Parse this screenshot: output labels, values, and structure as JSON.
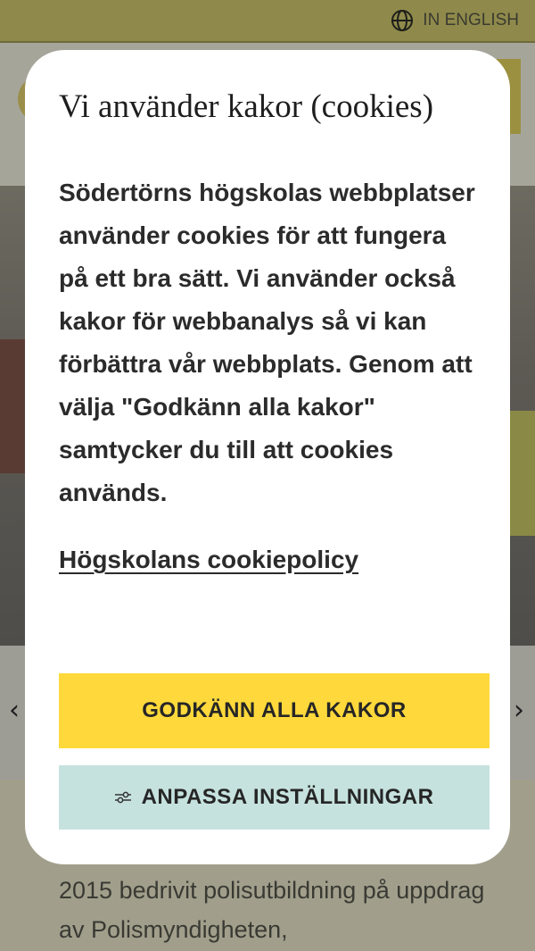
{
  "topbar": {
    "language_link": "IN ENGLISH",
    "language_icon": "globe-icon"
  },
  "cookie_modal": {
    "title": "Vi använder kakor (cookies)",
    "body": "Södertörns högskolas webbplatser använder cookies för att fungera på ett bra sätt. Vi använder också kakor för webbanalys så vi kan förbättra vår webbplats. Genom att välja \"Godkänn alla kakor\" samtycker du till att cookies används.",
    "policy_link": "Högskolans cookiepolicy",
    "accept_button": "GODKÄNN ALLA KAKOR",
    "customize_button": "ANPASSA INSTÄLLNINGAR",
    "customize_icon": "sliders-icon"
  },
  "background": {
    "article_text": "2015 bedrivit polisutbildning på uppdrag av Polismyndigheten,"
  },
  "colors": {
    "accept_bg": "#ffd93b",
    "customize_bg": "#c6e2df",
    "modal_bg": "#ffffff"
  }
}
